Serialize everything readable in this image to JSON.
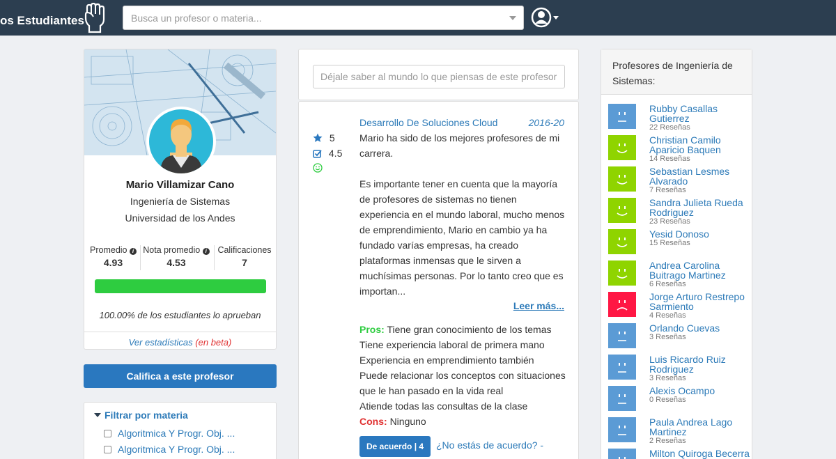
{
  "navbar": {
    "brand": "os Estudiantes",
    "search_placeholder": "Busca un profesor o materia..."
  },
  "profile": {
    "name": "Mario Villamizar Cano",
    "department": "Ingeniería de Sistemas",
    "university": "Universidad de los Andes",
    "stats": [
      {
        "label": "Promedio",
        "value": "4.93"
      },
      {
        "label": "Nota promedio",
        "value": "4.53"
      },
      {
        "label": "Calificaciones",
        "value": "7"
      }
    ],
    "approval_fraction": 1.0,
    "approval_text": "100.00% de los estudiantes lo aprueban",
    "stats_link": "Ver estadísticas",
    "beta_label": "(en beta)",
    "bar_color": "#2ecc40"
  },
  "rate_button": "Califica a este profesor",
  "filter": {
    "title": "Filtrar por materia",
    "items": [
      "Algoritmica Y Progr. Obj. ...",
      "Algoritmica Y Progr. Obj. ..."
    ]
  },
  "post": {
    "placeholder": "Déjale saber al mundo lo que piensas de este profesor"
  },
  "review": {
    "course": "Desarrollo De Soluciones Cloud",
    "date": "2016-20",
    "rating": "5",
    "grade": "4.5",
    "paragraphs": [
      "Mario ha sido de los mejores profesores de mi carrera.",
      "Es importante tener en cuenta que la mayoría de profesores de sistemas no tienen experiencia en el mundo laboral, mucho menos de emprendimiento, Mario en cambio ya ha fundado varías empresas, ha creado plataformas inmensas que le sirven a muchísimas personas. Por lo tanto creo que es importan..."
    ],
    "read_more": "Leer más...",
    "pros_label": "Pros:",
    "pros": [
      "Tiene gran conocimiento de los temas",
      "Tiene experiencia laboral de primera mano",
      "Experiencia en emprendimiento también",
      "Puede relacionar los conceptos con situaciones que le han pasado en la vida real",
      "Atiende todas las consultas de la clase"
    ],
    "cons_label": "Cons:",
    "cons": "Ninguno",
    "agree_label": "De acuerdo | 4",
    "disagree_label": "¿No estás de acuerdo?  -"
  },
  "sidebar": {
    "title": "Profesores de Ingeniería de Sistemas:",
    "professors": [
      {
        "name": "Rubby Casallas Gutierrez",
        "reviews": "22 Reseñas",
        "mood": "neutral"
      },
      {
        "name": "Christian Camilo Aparicio Baquen",
        "reviews": "14 Reseñas",
        "mood": "happy"
      },
      {
        "name": "Sebastian Lesmes Alvarado",
        "reviews": "7 Reseñas",
        "mood": "happy"
      },
      {
        "name": "Sandra Julieta Rueda Rodriguez",
        "reviews": "23 Reseñas",
        "mood": "happy"
      },
      {
        "name": "Yesid Donoso",
        "reviews": "15 Reseñas",
        "mood": "happy"
      },
      {
        "name": "Andrea Carolina Buitrago Martinez",
        "reviews": "6 Reseñas",
        "mood": "happy"
      },
      {
        "name": "Jorge Arturo Restrepo Sarmiento",
        "reviews": "4 Reseñas",
        "mood": "sad"
      },
      {
        "name": "Orlando Cuevas",
        "reviews": "3 Reseñas",
        "mood": "neutral"
      },
      {
        "name": "Luis Ricardo Ruiz Rodriguez",
        "reviews": "3 Reseñas",
        "mood": "neutral"
      },
      {
        "name": "Alexis Ocampo",
        "reviews": "0 Reseñas",
        "mood": "neutral"
      },
      {
        "name": "Paula Andrea Lago Martinez",
        "reviews": "2 Reseñas",
        "mood": "neutral"
      },
      {
        "name": "Milton Quiroga Becerra",
        "reviews": "",
        "mood": "neutral"
      }
    ],
    "mood_colors": {
      "neutral": "#5b9bd5",
      "happy": "#8fd400",
      "sad": "#ff1744"
    }
  }
}
